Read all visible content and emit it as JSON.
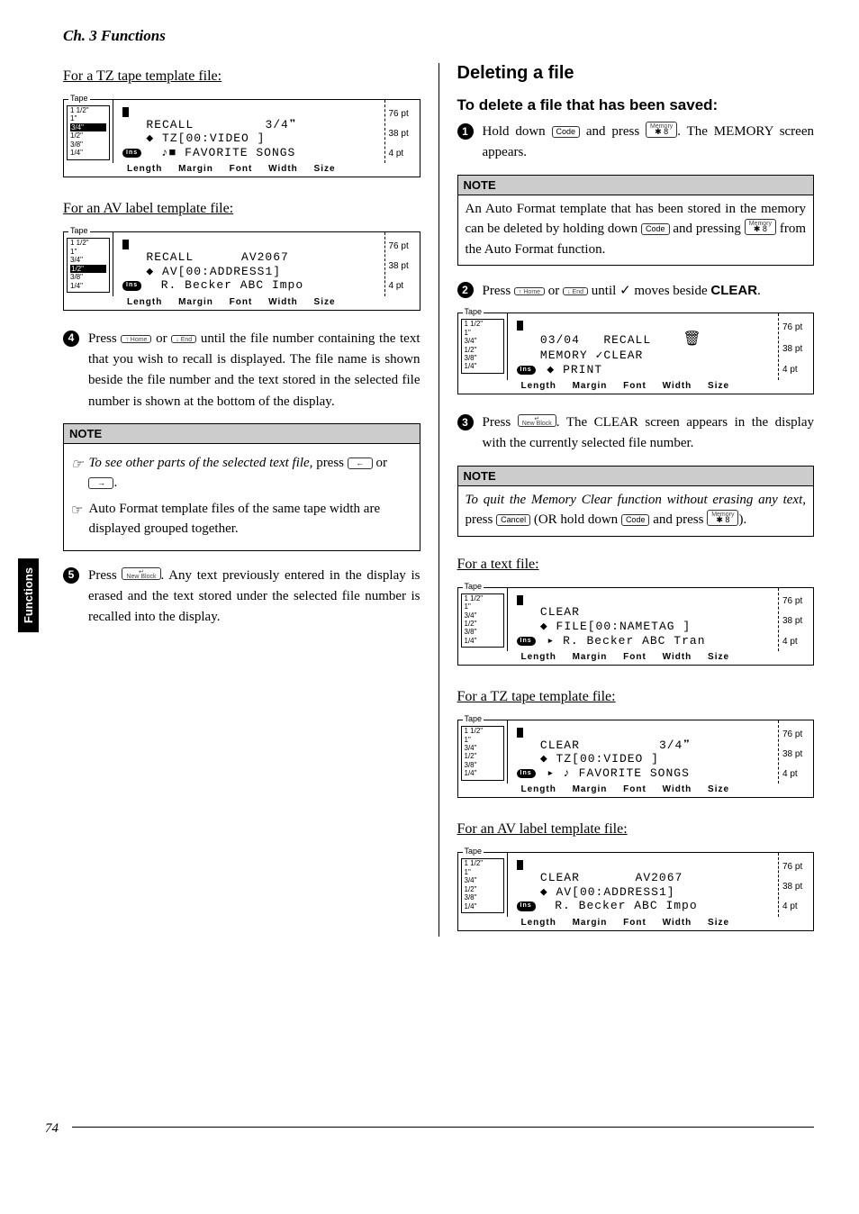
{
  "chapter": "Ch. 3 Functions",
  "sideTab": "Functions",
  "pageNum": "74",
  "keys": {
    "code": "Code",
    "memory": "Memory",
    "star8": "✱\n8",
    "upHome": "↑\nHome",
    "downEnd": "↓\nEnd",
    "newBlock": "New\nBlock",
    "left": "←",
    "right": "→",
    "cancel": "Cancel"
  },
  "lcdCommon": {
    "tapeLabel": "Tape",
    "tapeSizes": [
      "1 1/2\"",
      "1\"",
      "3/4\"",
      "1/2\"",
      "3/8\"",
      "1/4\""
    ],
    "ptSizes": [
      "76 pt",
      "38 pt",
      "4 pt"
    ],
    "bottomLabels": "Length Margin Font Width Size",
    "ins": "Ins"
  },
  "left": {
    "tzTitle": "For a TZ tape template file:",
    "avTitle": "For an AV label template file:",
    "lcdTZ": {
      "line1a": "RECALL",
      "line1b": "3/4❞",
      "line2": "   TZ[00:VIDEO    ]",
      "line3": "  FAVORITE SONGS"
    },
    "lcdAV": {
      "line1a": "RECALL",
      "line1b": "AV2067",
      "line2": "  AV[00:ADDRESS1]",
      "line3": "R. Becker   ABC Impo"
    },
    "step4": "until the file number containing the text that you wish to recall is displayed. The file name is shown beside the file number and the text stored in the selected file number is shown at the bottom of the display.",
    "noteLabel": "NOTE",
    "tip1a": "To see other parts of the selected text file,",
    "tip1b": "press",
    "tip1c": "or",
    "tip2": "Auto Format template files of the same tape width are displayed grouped together.",
    "step5": ". Any text previously entered in the display is erased and the text stored under the selected file number is recalled into the display."
  },
  "right": {
    "h1": "Deleting a file",
    "h2": "To delete a file that has been saved:",
    "step1a": "Hold down",
    "step1b": "and press",
    "step1c": ". The MEMORY screen appears.",
    "noteLabel": "NOTE",
    "note1a": "An Auto Format template that has been stored in the memory can be deleted by holding down",
    "note1b": "and pressing",
    "note1c": "from the Auto Format function.",
    "step2a": "Press",
    "step2b": "or",
    "step2c": "until",
    "step2d": "moves beside",
    "step2e": "CLEAR",
    "lcdMem": {
      "line1a": "03/04",
      "line1b": "RECALL",
      "line2": "MEMORY ✓CLEAR",
      "line3": "        PRINT"
    },
    "step3a": "Press",
    "step3b": ". The CLEAR screen appears in the display with the currently selected file number.",
    "note2a": "To quit the Memory Clear function without erasing any text,",
    "note2b": "press",
    "note2c": "(OR hold down",
    "note2d": "and press",
    "note2e": ").",
    "textFileTitle": "For a text file:",
    "lcdText": {
      "line1": "CLEAR",
      "line2": "  FILE[00:NAMETAG ]",
      "line3": "  R. Becker  ABC Tran"
    },
    "tzTitle": "For a TZ tape template file:",
    "lcdTZ": {
      "line1a": "CLEAR",
      "line1b": "3/4❞",
      "line2": "   TZ[00:VIDEO    ]",
      "line3": "   FAVORITE SONGS"
    },
    "avTitle": "For an AV label template file:",
    "lcdAV": {
      "line1a": "CLEAR",
      "line1b": "AV2067",
      "line2": "  AV[00:ADDRESS1]",
      "line3": "R. Becker  ABC Impo"
    }
  }
}
